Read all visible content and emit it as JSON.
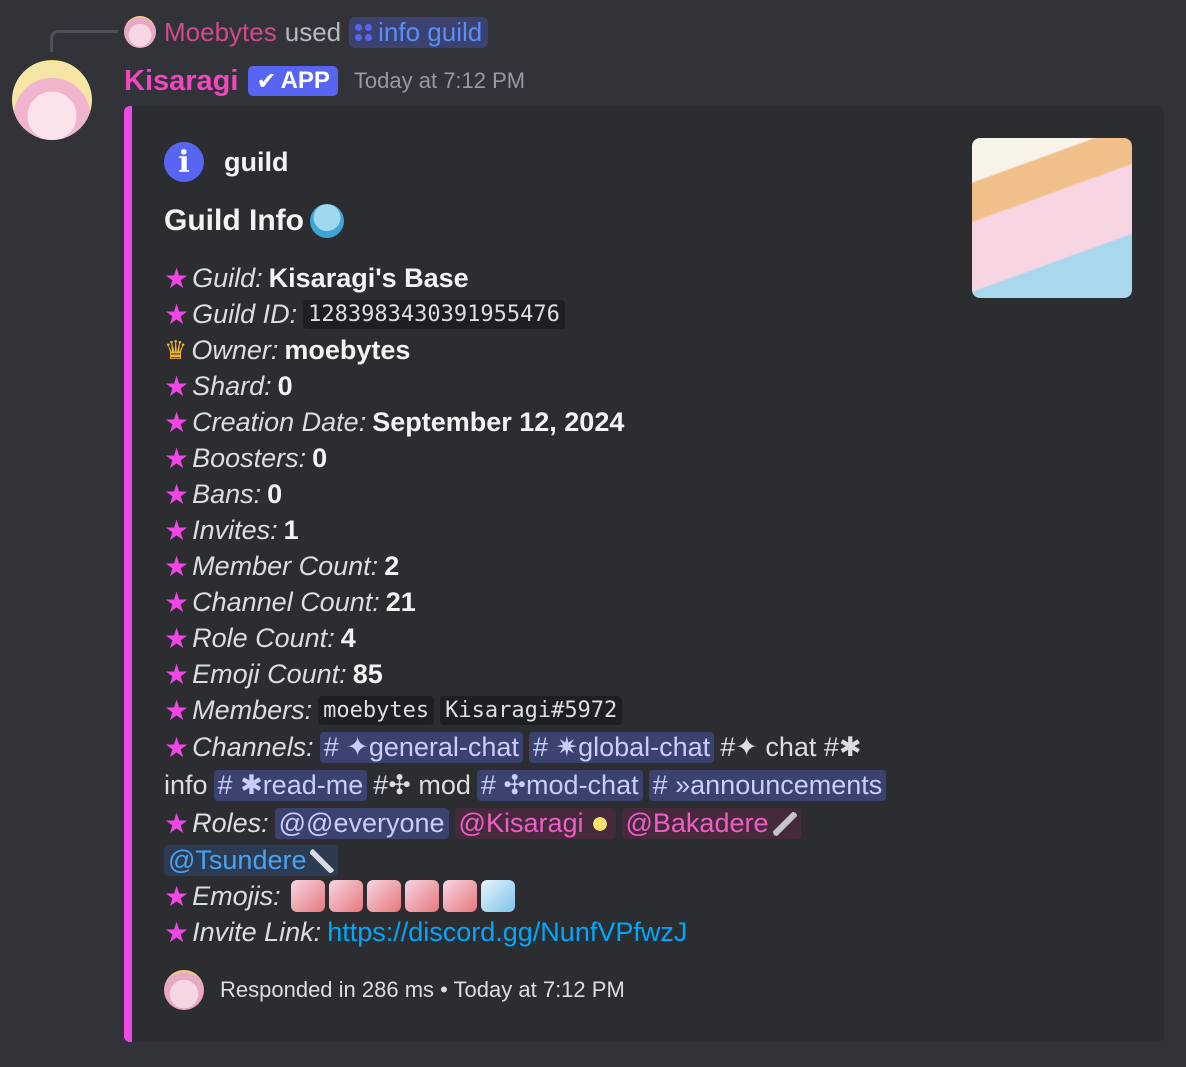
{
  "reply": {
    "user": "Moebytes",
    "used": "used",
    "command": "info guild"
  },
  "message": {
    "author": "Kisaragi",
    "badge": "APP",
    "badge_check": "✔",
    "timestamp": "Today at 7:12 PM"
  },
  "embed": {
    "author": "guild",
    "info_icon_glyph": "i",
    "title": "Guild Info",
    "accent": "#f047e6",
    "fields": {
      "guild": {
        "key": "Guild:",
        "value": "Kisaragi's Base"
      },
      "guild_id": {
        "key": "Guild ID:",
        "value": "1283983430391955476"
      },
      "owner": {
        "key": "Owner:",
        "value": "moebytes"
      },
      "shard": {
        "key": "Shard:",
        "value": "0"
      },
      "creation": {
        "key": "Creation Date:",
        "value": "September 12, 2024"
      },
      "boosters": {
        "key": "Boosters:",
        "value": "0"
      },
      "bans": {
        "key": "Bans:",
        "value": "0"
      },
      "invites": {
        "key": "Invites:",
        "value": "1"
      },
      "member_count": {
        "key": "Member Count:",
        "value": "2"
      },
      "channel_count": {
        "key": "Channel Count:",
        "value": "21"
      },
      "role_count": {
        "key": "Role Count:",
        "value": "4"
      },
      "emoji_count": {
        "key": "Emoji Count:",
        "value": "85"
      },
      "members": {
        "key": "Members:",
        "values": [
          "moebytes",
          "Kisaragi#5972"
        ]
      },
      "channels": {
        "key": "Channels:",
        "c1": "# ✦general-chat",
        "c2": "# ✷global-chat",
        "p1": "#✦ chat #✱",
        "p2": "info",
        "c3": "# ✱read-me",
        "p3": "#✣ mod",
        "c4": "# ✣mod-chat",
        "c5": "# »announcements"
      },
      "roles": {
        "key": "Roles:",
        "values": [
          "@@everyone",
          "@Kisaragi",
          "@Bakadere",
          "@Tsundere"
        ]
      },
      "emojis": {
        "key": "Emojis:"
      },
      "invite": {
        "key": "Invite Link:",
        "value": "https://discord.gg/NunfVPfwzJ"
      }
    },
    "star_glyph": "★",
    "crown_glyph": "♛",
    "footer": "Responded in 286 ms • Today at 7:12 PM"
  }
}
